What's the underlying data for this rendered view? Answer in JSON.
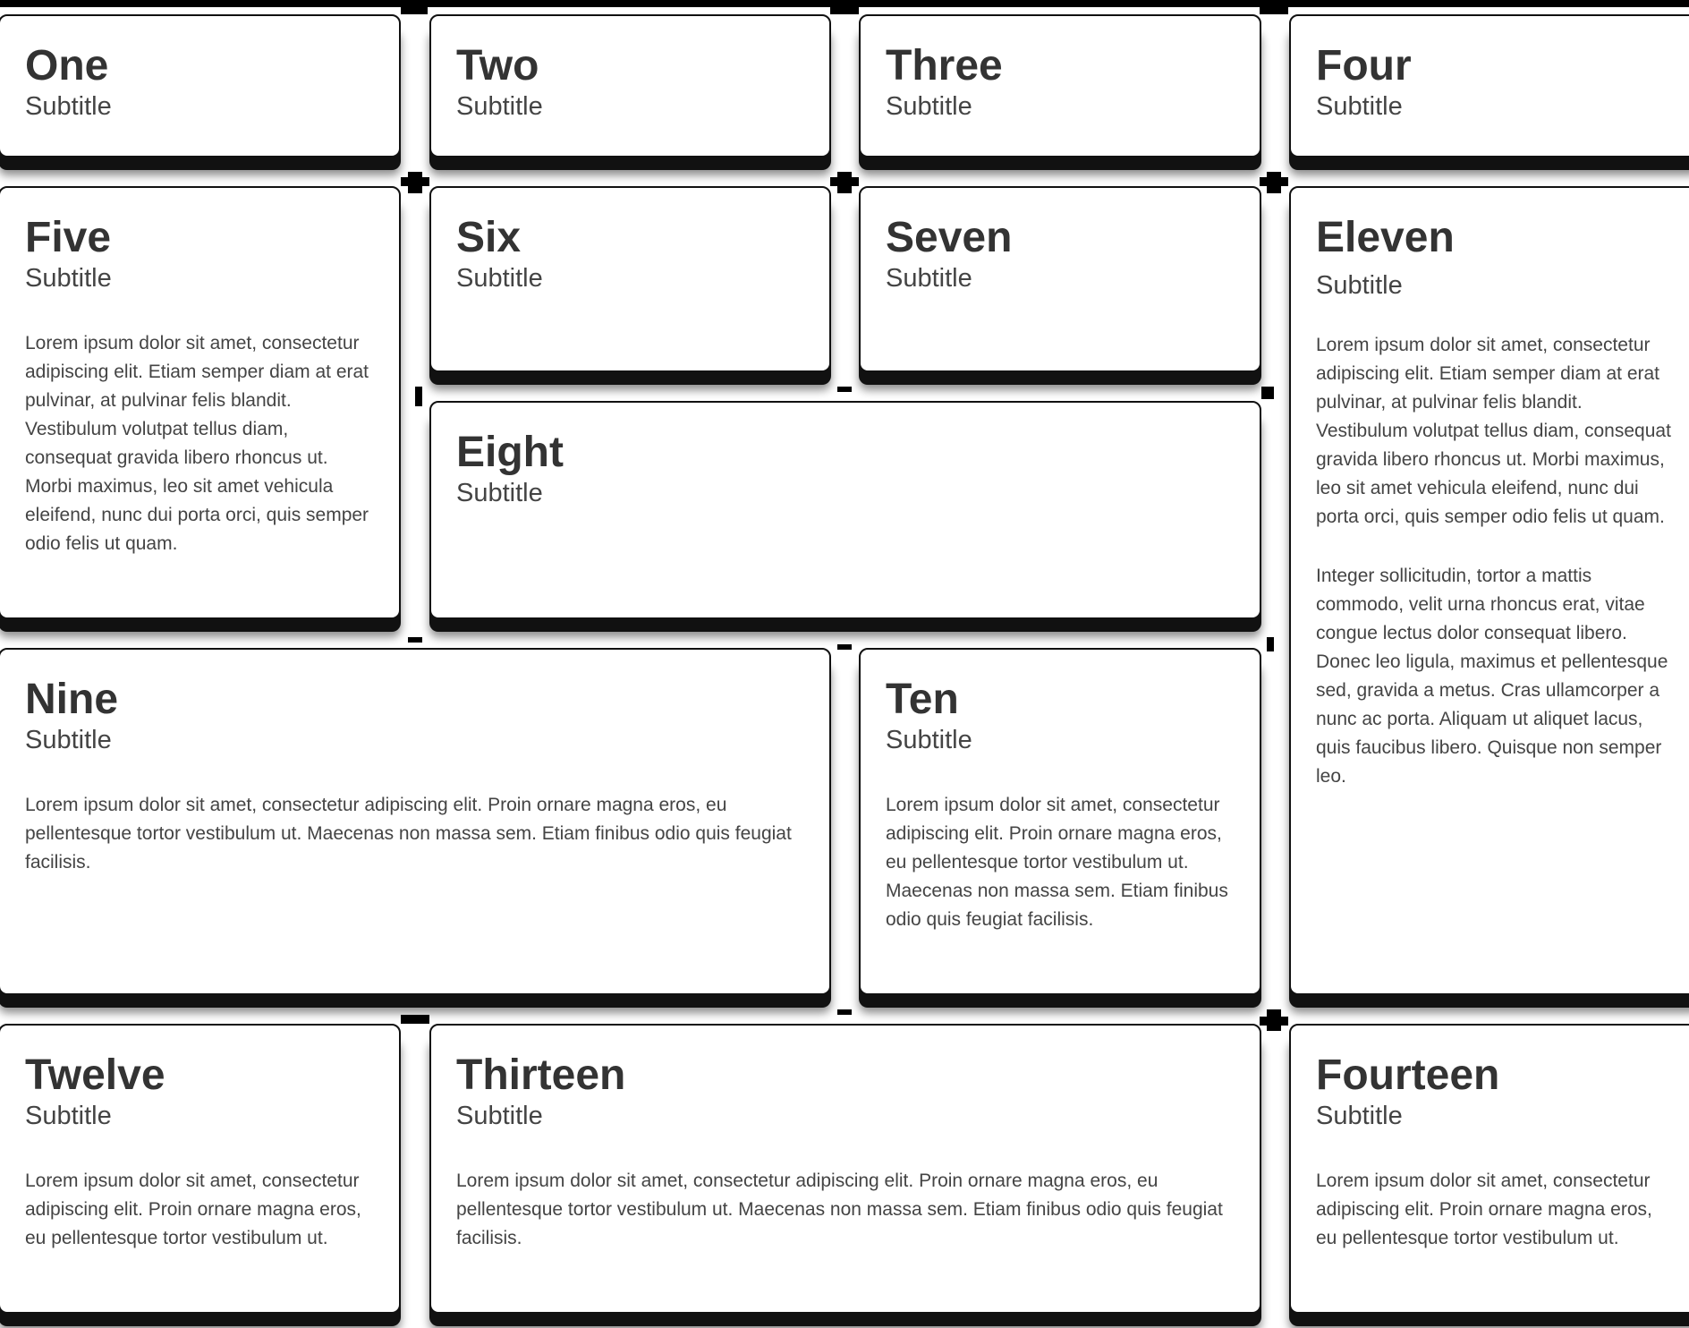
{
  "cards": [
    {
      "title": "One",
      "subtitle": "Subtitle"
    },
    {
      "title": "Two",
      "subtitle": "Subtitle"
    },
    {
      "title": "Three",
      "subtitle": "Subtitle"
    },
    {
      "title": "Four",
      "subtitle": "Subtitle"
    },
    {
      "title": "Five",
      "subtitle": "Subtitle",
      "body": [
        "Lorem ipsum dolor sit amet, consectetur adipiscing elit. Etiam semper diam at erat pulvinar, at pulvinar felis blandit. Vestibulum volutpat tellus diam, consequat gravida libero rhoncus ut. Morbi maximus, leo sit amet vehicula eleifend, nunc dui porta orci, quis semper odio felis ut quam."
      ]
    },
    {
      "title": "Six",
      "subtitle": "Subtitle"
    },
    {
      "title": "Seven",
      "subtitle": "Subtitle"
    },
    {
      "title": "Eight",
      "subtitle": "Subtitle"
    },
    {
      "title": "Nine",
      "subtitle": "Subtitle",
      "body": [
        "Lorem ipsum dolor sit amet, consectetur adipiscing elit. Proin ornare magna eros, eu pellentesque tortor vestibulum ut. Maecenas non massa sem. Etiam finibus odio quis feugiat facilisis."
      ]
    },
    {
      "title": "Ten",
      "subtitle": "Subtitle",
      "body": [
        "Lorem ipsum dolor sit amet, consectetur adipiscing elit. Proin ornare magna eros, eu pellentesque tortor vestibulum ut. Maecenas non massa sem. Etiam finibus odio quis feugiat facilisis."
      ]
    },
    {
      "title": "Eleven",
      "subtitle": "Subtitle",
      "body": [
        "Lorem ipsum dolor sit amet, consectetur adipiscing elit. Etiam semper diam at erat pulvinar, at pulvinar felis blandit. Vestibulum volutpat tellus diam, consequat gravida libero rhoncus ut. Morbi maximus, leo sit amet vehicula eleifend, nunc dui porta orci, quis semper odio felis ut quam.",
        "Integer sollicitudin, tortor a mattis commodo, velit urna rhoncus erat, vitae congue lectus dolor consequat libero. Donec leo ligula, maximus et pellentesque sed, gravida a metus. Cras ullamcorper a nunc ac porta. Aliquam ut aliquet lacus, quis faucibus libero. Quisque non semper leo."
      ]
    },
    {
      "title": "Twelve",
      "subtitle": "Subtitle",
      "body": [
        "Lorem ipsum dolor sit amet, consectetur adipiscing elit. Proin ornare magna eros, eu pellentesque tortor vestibulum ut."
      ]
    },
    {
      "title": "Thirteen",
      "subtitle": "Subtitle",
      "body": [
        "Lorem ipsum dolor sit amet, consectetur adipiscing elit. Proin ornare magna eros, eu pellentesque tortor vestibulum ut. Maecenas non massa sem. Etiam finibus odio quis feugiat facilisis."
      ]
    },
    {
      "title": "Fourteen",
      "subtitle": "Subtitle",
      "body": [
        "Lorem ipsum dolor sit amet, consectetur adipiscing elit. Proin ornare magna eros, eu pellentesque tortor vestibulum ut."
      ]
    }
  ]
}
